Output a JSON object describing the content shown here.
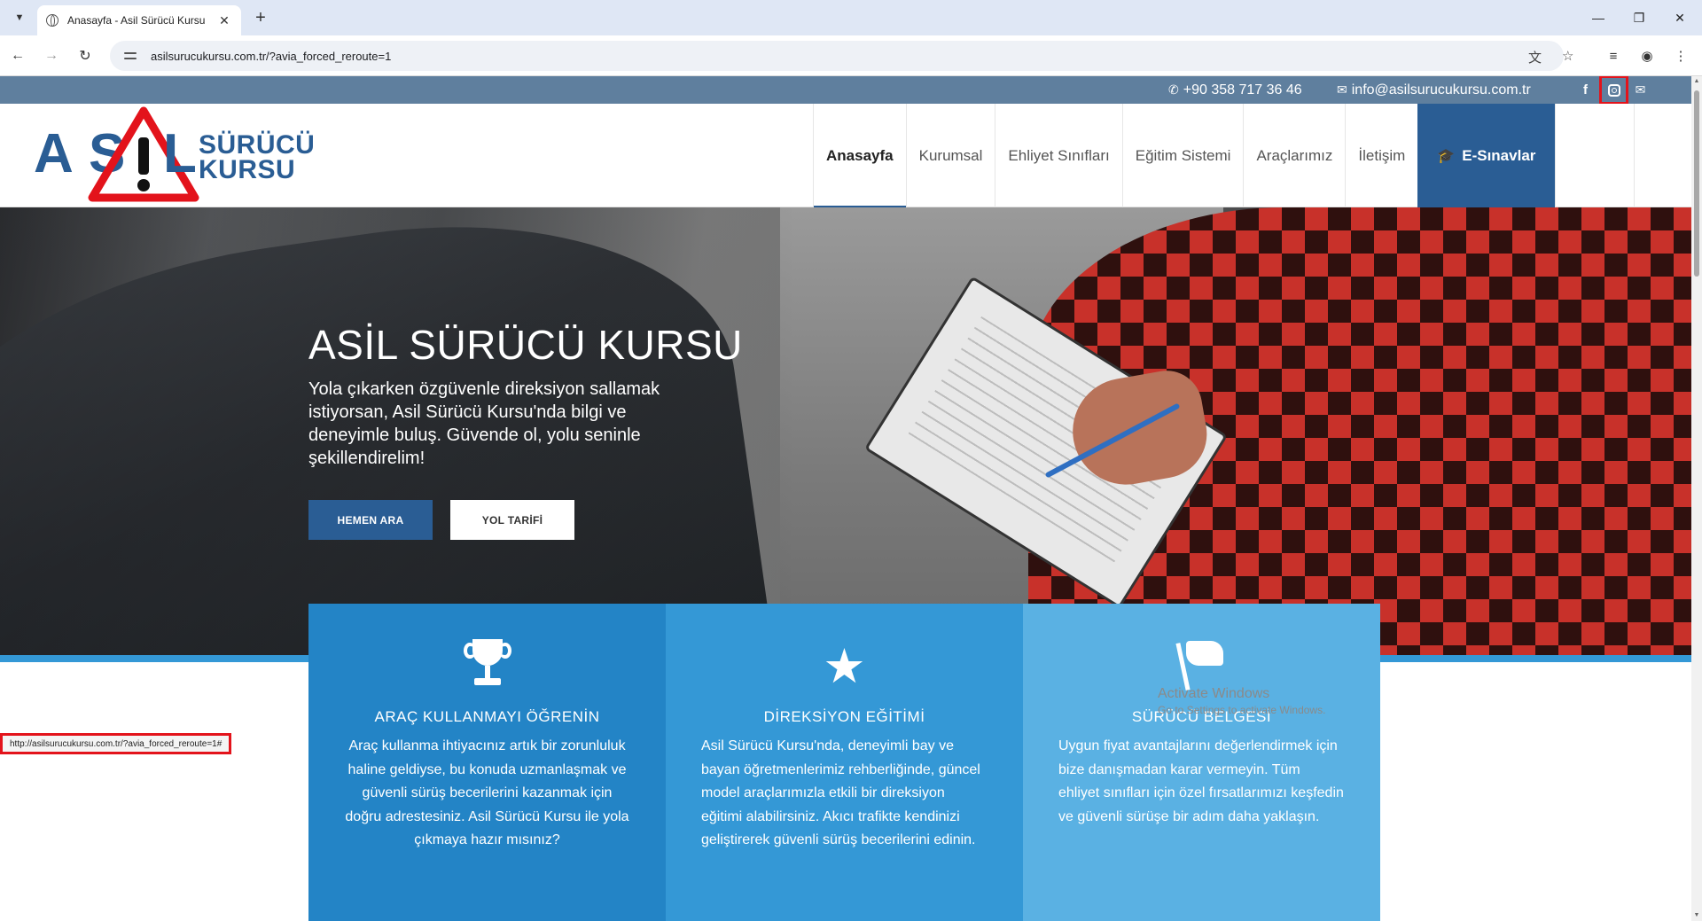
{
  "browser": {
    "tab": {
      "title": "Anasayfa - Asil Sürücü Kursu"
    },
    "address": {
      "url": "asilsurucukursu.com.tr/?avia_forced_reroute=1"
    },
    "status_url": "http://asilsurucukursu.com.tr/?avia_forced_reroute=1#"
  },
  "topbar": {
    "phone": "+90 358 717 36 46",
    "email": "info@asilsurucukursu.com.tr",
    "social": [
      "facebook-icon",
      "instagram-icon",
      "mail-icon"
    ]
  },
  "logo": {
    "letters": [
      "A",
      "S",
      "L"
    ],
    "line1": "SÜRÜCÜ",
    "line2": "KURSU"
  },
  "nav": {
    "items": [
      "Anasayfa",
      "Kurumsal",
      "Ehliyet Sınıfları",
      "Eğitim Sistemi",
      "Araçlarımız",
      "İletişim"
    ],
    "active": "Anasayfa",
    "cta": "E-Sınavlar"
  },
  "hero": {
    "title": "ASİL SÜRÜCÜ KURSU",
    "text": "Yola çıkarken özgüvenle direksiyon sallamak istiyorsan, Asil Sürücü Kursu'nda bilgi ve deneyimle buluş. Güvende ol, yolu seninle şekillendirelim!",
    "button_primary": "HEMEN ARA",
    "button_secondary": "YOL TARİFİ"
  },
  "features": [
    {
      "icon": "trophy-icon",
      "title": "ARAÇ KULLANMAYI ÖĞRENİN",
      "text": "Araç kullanma ihtiyacınız artık bir zorunluluk haline geldiyse, bu konuda uzmanlaşmak ve güvenli sürüş becerilerini kazanmak için doğru adrestesiniz. Asil Sürücü Kursu ile yola çıkmaya hazır mısınız?"
    },
    {
      "icon": "star-icon",
      "title": "DİREKSİYON EĞİTİMİ",
      "text": "Asil Sürücü Kursu'nda, deneyimli bay ve bayan öğretmenlerimiz rehberliğinde, güncel model araçlarımızla etkili bir direksiyon eğitimi alabilirsiniz. Akıcı trafikte kendinizi geliştirerek güvenli sürüş becerilerini edinin."
    },
    {
      "icon": "flag-icon",
      "title": "SÜRÜCÜ BELGESİ",
      "text": "Uygun fiyat avantajlarını değerlendirmek için bize danışmadan karar vermeyin. Tüm ehliyet sınıfları için özel fırsatlarımızı keşfedin ve güvenli sürüşe bir adım daha yaklaşın."
    }
  ],
  "watermark": {
    "title": "Activate Windows",
    "subtitle": "Go to Settings to activate Windows."
  },
  "colors": {
    "brand": "#2a5d94",
    "topbar": "#5f7f9e",
    "feature1": "#2384c6",
    "feature2": "#3498d6",
    "feature3": "#5ab1e3",
    "highlight": "#e3131b"
  }
}
